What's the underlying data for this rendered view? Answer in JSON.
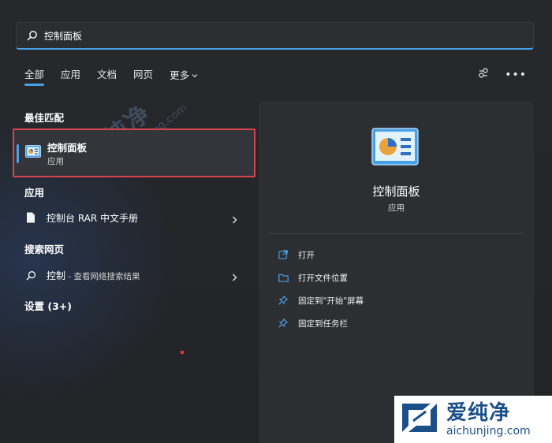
{
  "search": {
    "value": "控制面板"
  },
  "tabs": [
    {
      "label": "全部",
      "active": true
    },
    {
      "label": "应用"
    },
    {
      "label": "文档"
    },
    {
      "label": "网页"
    },
    {
      "label": "更多"
    }
  ],
  "sections": {
    "best_match": "最佳匹配",
    "apps": "应用",
    "web": "搜索网页",
    "settings": "设置 (3+)"
  },
  "best_match_item": {
    "title": "控制面板",
    "subtitle": "应用",
    "icon": "control-panel-icon"
  },
  "app_results": [
    {
      "label": "控制台 RAR 中文手册",
      "icon": "document-icon"
    }
  ],
  "web_results": [
    {
      "label": "控制",
      "suffix": " - 查看网络搜索结果",
      "icon": "search-icon"
    }
  ],
  "detail": {
    "title": "控制面板",
    "subtitle": "应用",
    "actions": [
      {
        "label": "打开",
        "icon": "open-external-icon"
      },
      {
        "label": "打开文件位置",
        "icon": "folder-icon"
      },
      {
        "label": "固定到\"开始\"屏幕",
        "icon": "pin-icon"
      },
      {
        "label": "固定到任务栏",
        "icon": "pin-icon"
      }
    ]
  },
  "watermark": {
    "cn": "爱纯净",
    "en": "aichunjing.com"
  },
  "colors": {
    "accent": "#4aa0e6",
    "highlight_border": "#d9434c",
    "background": "#202226",
    "panel": "#2d2e32"
  }
}
